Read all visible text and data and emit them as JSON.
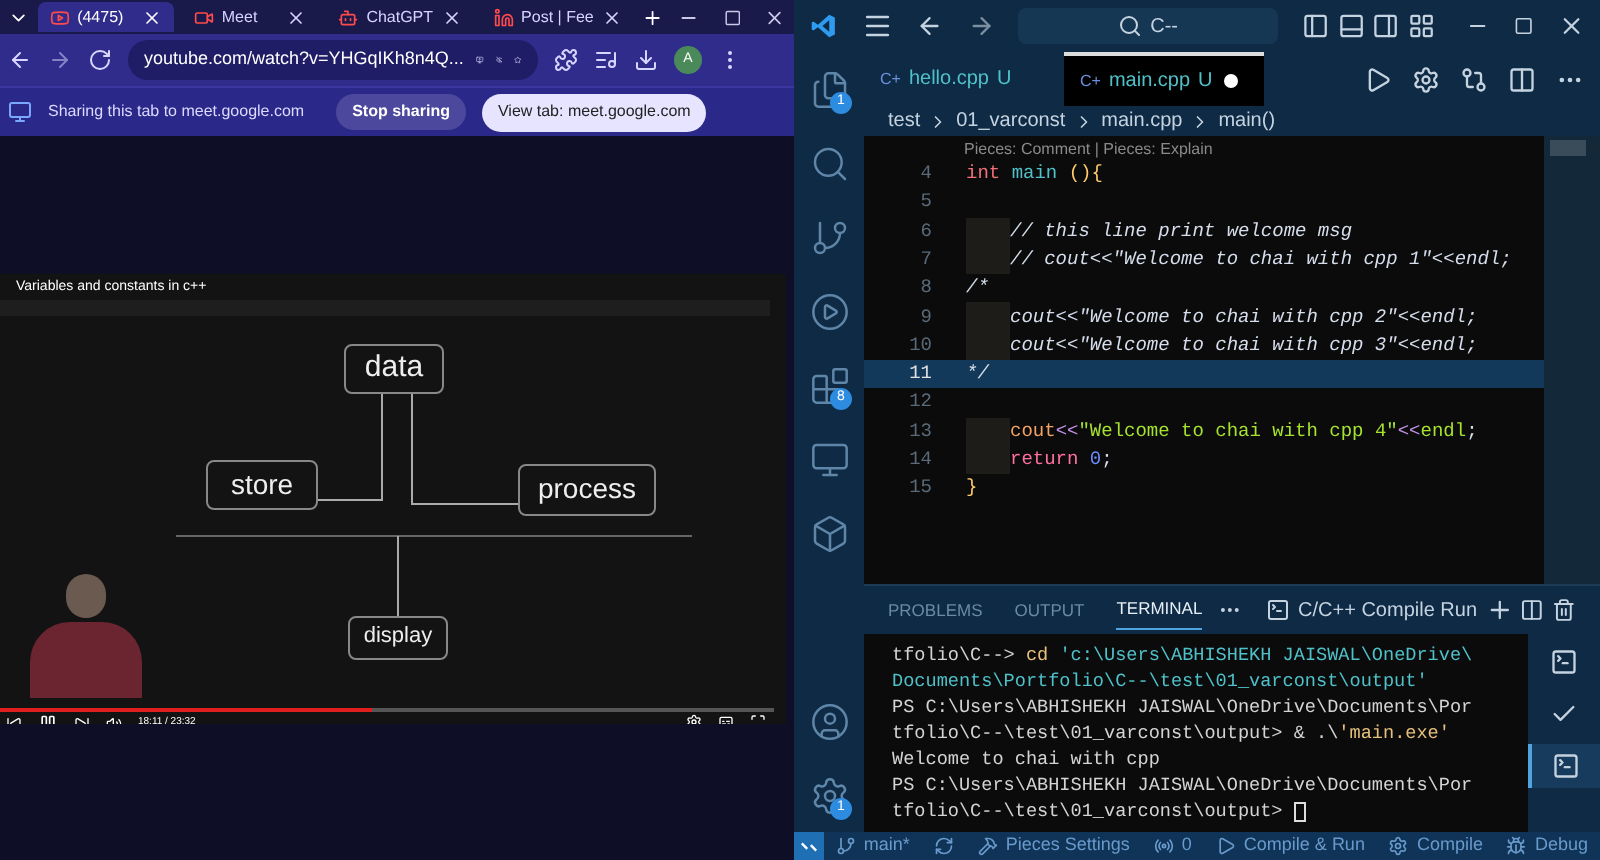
{
  "browser": {
    "tabs": [
      {
        "title": "(4475)",
        "kind": "video",
        "selected": true
      },
      {
        "title": "Meet",
        "kind": "meet",
        "selected": false
      },
      {
        "title": "ChatGPT",
        "kind": "chat",
        "selected": false
      },
      {
        "title": "Post | Fee",
        "kind": "post",
        "selected": false
      }
    ],
    "address": "youtube.com/watch?v=YHGqIKh8n4Q...",
    "profile_initial": "A",
    "sharing_bar": {
      "message": "Sharing this tab to meet.google.com",
      "stop_button": "Stop sharing",
      "view_button": "View tab: meet.google.com"
    },
    "video": {
      "title": "Variables and constants in c++",
      "diagram": [
        {
          "label": "data"
        },
        {
          "label": "store"
        },
        {
          "label": "process"
        },
        {
          "label": "display"
        }
      ],
      "time": "18:11 / 23:32",
      "progress": {
        "level": 0.48
      }
    }
  },
  "vscode": {
    "search": "C--",
    "activity_bar": [
      {
        "kind": "files",
        "badge": "1"
      },
      {
        "kind": "search"
      },
      {
        "kind": "source-control"
      },
      {
        "kind": "run-debug"
      },
      {
        "kind": "extensions",
        "badge": "8"
      },
      {
        "kind": "remote"
      },
      {
        "kind": "package"
      }
    ],
    "activity_bottom": [
      {
        "kind": "account"
      },
      {
        "kind": "settings",
        "badge": "1"
      }
    ],
    "tabs": [
      {
        "icon": "C+",
        "name": "hello.cpp",
        "status": "U",
        "selected": false,
        "modified": false
      },
      {
        "icon": "C+",
        "name": "main.cpp",
        "status": "U",
        "selected": true,
        "modified": true
      }
    ],
    "breadcrumb": [
      "test",
      "01_varconst",
      "main.cpp",
      "main()"
    ],
    "codelens": "Pieces: Comment | Pieces: Explain",
    "lines": [
      {
        "number": "4",
        "current": false,
        "indent": false,
        "tokens": [
          {
            "kind": "type",
            "text": "int "
          },
          {
            "kind": "func",
            "text": "main "
          },
          {
            "kind": "brace",
            "text": "(){"
          }
        ]
      },
      {
        "number": "5",
        "current": false,
        "indent": false
      },
      {
        "number": "6",
        "current": false,
        "indent": true,
        "tokens": [
          {
            "kind": "comment",
            "text": "// this line print welcome msg"
          }
        ]
      },
      {
        "number": "7",
        "current": false,
        "indent": true,
        "tokens": [
          {
            "kind": "comment",
            "text": "// cout<<\"Welcome to chai with cpp 1\"<<endl;"
          }
        ]
      },
      {
        "number": "8",
        "current": false,
        "indent": false,
        "tokens": [
          {
            "kind": "comment",
            "text": "/*"
          }
        ]
      },
      {
        "number": "9",
        "current": false,
        "indent": true,
        "tokens": [
          {
            "kind": "comment",
            "text": "cout<<\"Welcome to chai with cpp 2\"<<endl;"
          }
        ]
      },
      {
        "number": "10",
        "current": false,
        "indent": true,
        "tokens": [
          {
            "kind": "comment",
            "text": "cout<<\"Welcome to chai with cpp 3\"<<endl;"
          }
        ]
      },
      {
        "number": "11",
        "current": true,
        "indent": false,
        "tokens": [
          {
            "kind": "comment",
            "text": "*/"
          }
        ]
      },
      {
        "number": "12",
        "current": false,
        "indent": false
      },
      {
        "number": "13",
        "current": false,
        "indent": true,
        "tokens": [
          {
            "kind": "ident",
            "text": "cout"
          },
          {
            "kind": "op",
            "text": "<<"
          },
          {
            "kind": "string",
            "text": "\"Welcome to chai with cpp 4\""
          },
          {
            "kind": "op",
            "text": "<<"
          },
          {
            "kind": "string",
            "text": "endl"
          },
          {
            "kind": "plain",
            "text": ";"
          }
        ]
      },
      {
        "number": "14",
        "current": false,
        "indent": true,
        "tokens": [
          {
            "kind": "kw",
            "text": "return "
          },
          {
            "kind": "num",
            "text": "0"
          },
          {
            "kind": "plain",
            "text": ";"
          }
        ]
      },
      {
        "number": "15",
        "current": false,
        "indent": false,
        "tokens": [
          {
            "kind": "brace",
            "text": "}"
          }
        ]
      }
    ],
    "panel_tabs": [
      {
        "label": "PROBLEMS",
        "selected": false
      },
      {
        "label": "OUTPUT",
        "selected": false
      },
      {
        "label": "TERMINAL",
        "selected": true
      }
    ],
    "terminal_name": "C/C++ Compile Run",
    "terminal_lines": [
      [
        {
          "kind": "plain",
          "text": "tfolio\\C--> "
        },
        {
          "kind": "cmd",
          "text": "cd"
        },
        {
          "kind": "path",
          "text": " 'c:\\Users\\ABHISHEKH JAISWAL\\OneDrive\\"
        }
      ],
      [
        {
          "kind": "path",
          "text": "Documents\\Portfolio\\C--\\test\\01_varconst\\output'"
        }
      ],
      [
        {
          "kind": "plain",
          "text": "PS C:\\Users\\ABHISHEKH JAISWAL\\OneDrive\\Documents\\Por"
        }
      ],
      [
        {
          "kind": "plain",
          "text": "tfolio\\C--\\test\\01_varconst\\output> & .\\"
        },
        {
          "kind": "cmd",
          "text": "'main.exe'"
        }
      ],
      [
        {
          "kind": "plain",
          "text": "Welcome to chai with cpp"
        }
      ],
      [
        {
          "kind": "plain",
          "text": "PS C:\\Users\\ABHISHEKH JAISWAL\\OneDrive\\Documents\\Por"
        }
      ],
      [
        {
          "kind": "plain",
          "text": "tfolio\\C--\\test\\01_varconst\\output> "
        },
        {
          "kind": "cursor"
        }
      ]
    ],
    "terminal_list": [
      {
        "kind": "terminal",
        "selected": false
      },
      {
        "kind": "check",
        "selected": false
      },
      {
        "kind": "terminal",
        "selected": true
      }
    ],
    "status_bar": [
      {
        "kind": "branch",
        "text": "main*"
      },
      {
        "kind": "sync"
      },
      {
        "kind": "pieces",
        "text": "Pieces Settings"
      },
      {
        "kind": "ports",
        "text": "0"
      },
      {
        "kind": "run",
        "text": "Compile & Run"
      },
      {
        "kind": "gear",
        "text": "Compile"
      },
      {
        "kind": "debug",
        "text": "Debug"
      }
    ]
  }
}
